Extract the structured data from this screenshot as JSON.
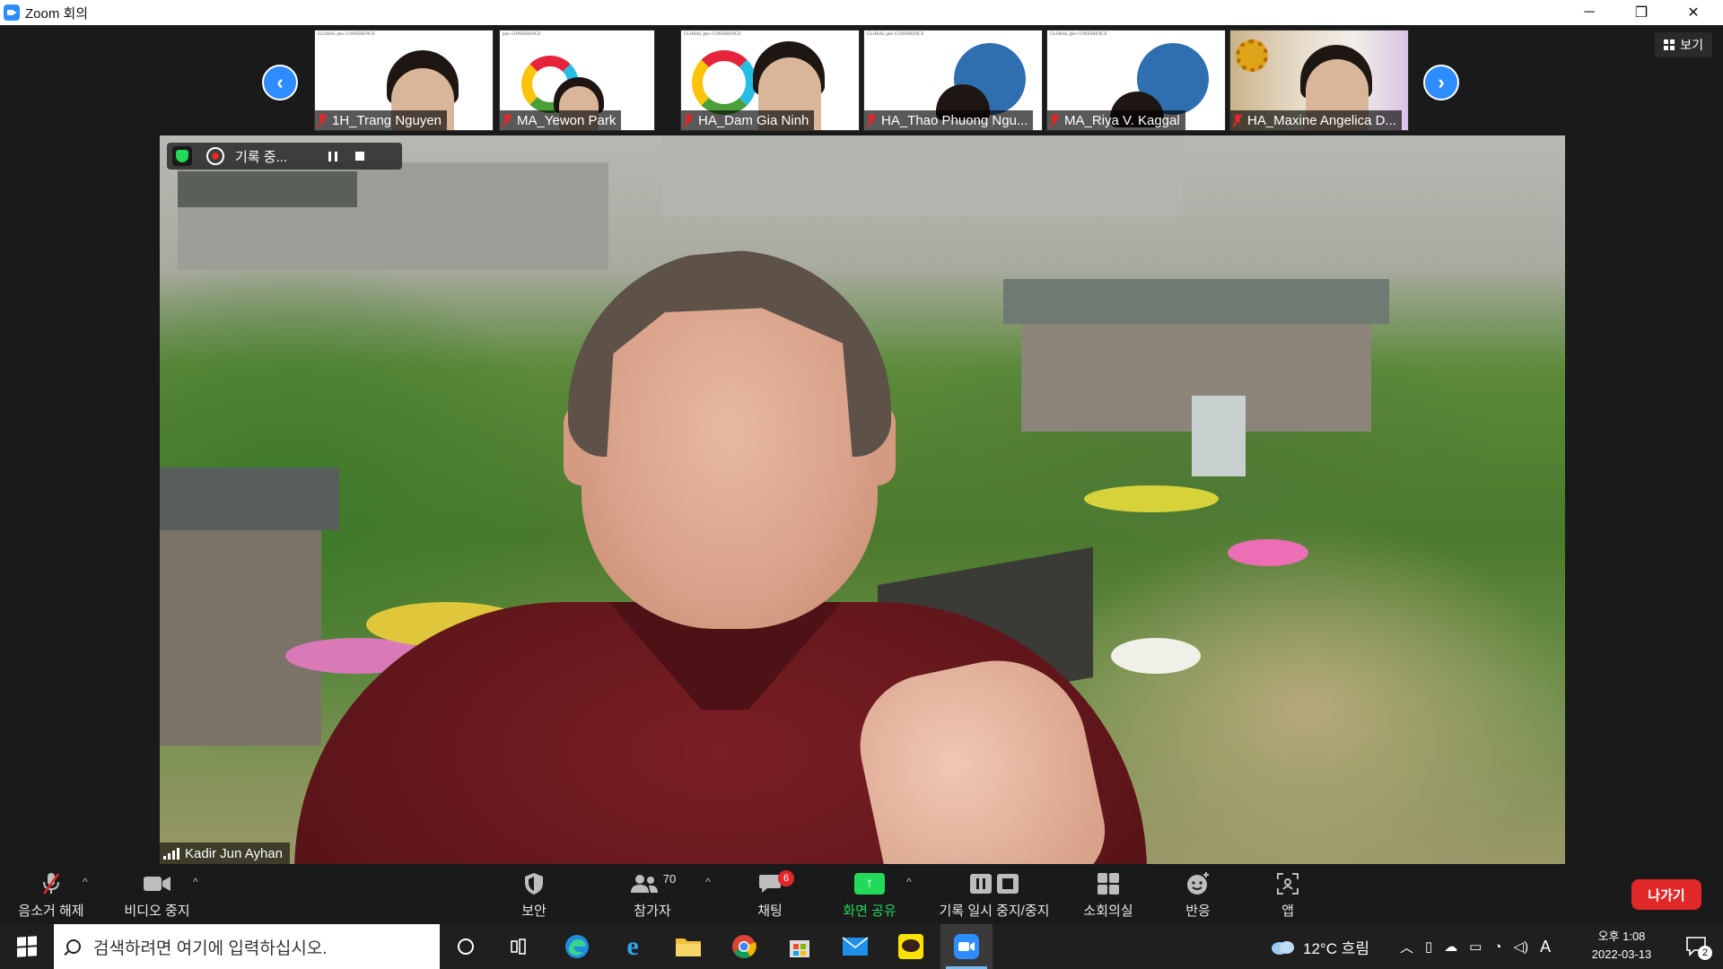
{
  "window": {
    "title": "Zoom 회의",
    "controls": {
      "minimize": "─",
      "restore": "❐",
      "close": "✕"
    }
  },
  "thumbnails": [
    {
      "name": "1H_Trang Nguyen",
      "banner": "GLOBAL glec CONFERENCE"
    },
    {
      "name": "MA_Yewon Park",
      "banner": "glec CONFERENCE"
    },
    {
      "name": "HA_Dam Gia Ninh",
      "banner": "GLOBAL glec CONFERENCE"
    },
    {
      "name": "HA_Thao Phuong Ngu...",
      "banner": "GLOBAL glec CONFERENCE"
    },
    {
      "name": "MA_Riya V. Kaggal",
      "banner": "GLOBAL glec CONFERENCE"
    },
    {
      "name": "HA_Maxine Angelica D..."
    }
  ],
  "nav": {
    "prev": "‹",
    "next": "›"
  },
  "view_button": {
    "label": "보기"
  },
  "recording": {
    "status": "기록 중..."
  },
  "main_speaker": {
    "name": "Kadir Jun Ayhan"
  },
  "toolbar": {
    "unmute": "음소거 해제",
    "stop_video": "비디오 중지",
    "security": "보안",
    "participants": "참가자",
    "participants_count": "70",
    "chat": "채팅",
    "chat_badge": "6",
    "share_screen": "화면 공유",
    "recording_controls": "기록 일시 중지/중지",
    "breakout": "소회의실",
    "reactions": "반응",
    "apps": "앱",
    "leave": "나가기"
  },
  "taskbar": {
    "search_placeholder": "검색하려면 여기에 입력하십시오.",
    "weather": "12°C 흐림",
    "ime": "A",
    "time": "오후 1:08",
    "date": "2022-03-13",
    "notifications": "2"
  },
  "colors": {
    "zoom_blue": "#2d8cff",
    "leave_red": "#e02828",
    "share_green": "#23d959"
  }
}
